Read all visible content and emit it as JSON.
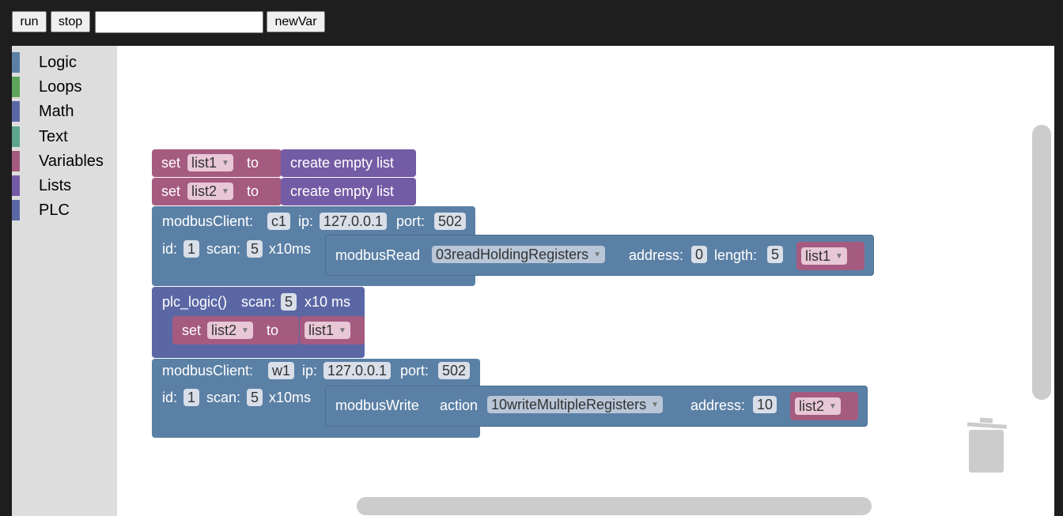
{
  "toolbar": {
    "run_label": "run",
    "stop_label": "stop",
    "input_value": "",
    "newvar_label": "newVar"
  },
  "toolbox": {
    "categories": [
      {
        "label": "Logic",
        "color": "#5b80a5"
      },
      {
        "label": "Loops",
        "color": "#5ba55b"
      },
      {
        "label": "Math",
        "color": "#5b67a5"
      },
      {
        "label": "Text",
        "color": "#5ba58c"
      },
      {
        "label": "Variables",
        "color": "#a55b80"
      },
      {
        "label": "Lists",
        "color": "#745ba5"
      },
      {
        "label": "PLC",
        "color": "#5b67a5"
      }
    ]
  },
  "colors": {
    "variables": "#a55b80",
    "lists": "#745ba5",
    "plc_blue": "#5b80a5",
    "plc_indigo": "#5b67a5"
  },
  "blocks": {
    "set1": {
      "set": "set",
      "var": "list1",
      "to": "to",
      "value": "create empty list"
    },
    "set2": {
      "set": "set",
      "var": "list2",
      "to": "to",
      "value": "create empty list"
    },
    "client1": {
      "label": "modbusClient:",
      "name": "c1",
      "ip_label": "ip:",
      "ip": "127.0.0.1",
      "port_label": "port:",
      "port": "502",
      "id_label": "id:",
      "id": "1",
      "scan_label": "scan:",
      "scan": "5",
      "unit": "x10ms",
      "read": {
        "label": "modbusRead",
        "func": "03readHoldingRegisters",
        "address_label": "address:",
        "address": "0",
        "length_label": "length:",
        "length": "5",
        "var": "list1"
      }
    },
    "plc": {
      "label": "plc_logic()",
      "scan_label": "scan:",
      "scan": "5",
      "unit": "x10 ms",
      "inner": {
        "set": "set",
        "var": "list2",
        "to": "to",
        "value": "list1"
      }
    },
    "client2": {
      "label": "modbusClient:",
      "name": "w1",
      "ip_label": "ip:",
      "ip": "127.0.0.1",
      "port_label": "port:",
      "port": "502",
      "id_label": "id:",
      "id": "1",
      "scan_label": "scan:",
      "scan": "5",
      "unit": "x10ms",
      "write": {
        "label": "modbusWrite",
        "action_label": "action",
        "func": "10writeMultipleRegisters",
        "address_label": "address:",
        "address": "10",
        "var": "list2"
      }
    }
  }
}
